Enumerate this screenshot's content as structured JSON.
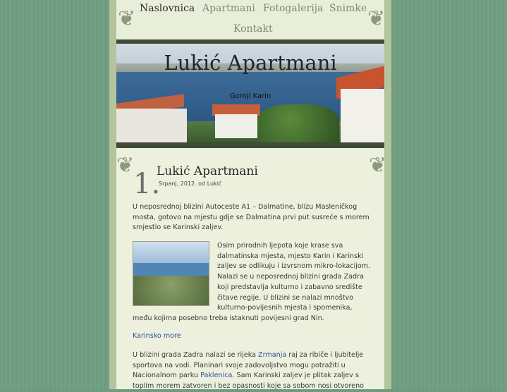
{
  "nav": {
    "items": [
      {
        "label": "Naslovnica",
        "active": true
      },
      {
        "label": "Apartmani",
        "active": false
      },
      {
        "label": "Fotogalerija",
        "active": false
      },
      {
        "label": "Snimke",
        "active": false
      },
      {
        "label": "Kontakt",
        "active": false
      }
    ]
  },
  "banner": {
    "title": "Lukić Apartmani",
    "subtitle": "Gornji Karin"
  },
  "post": {
    "number": "1.",
    "title": "Lukić Apartmani",
    "meta": "Srpanj, 2012. od Lukić",
    "para1": "U neposrednoj blizini Autoceste A1 – Dalmatine, blizu Masleničkog mosta, gotovo na mjestu gdje se Dalmatina prvi put susreće s morem smjestio se Karinski zaljev.",
    "para2": "Osim prirodnih ljepota koje krase sva dalmatinska mjesta, mjesto Karin i Karinski zaljev se odlikuju i izvrsnom mikro-lokacijom. Nalazi se u neposrednoj blizini grada Zadra koji predstavlja kulturno i zabavno središte čitave regije. U blizini se nalazi mnoštvo kulturno-povijesnih mjesta i spomenika, među kojima posebno treba istaknuti povijesni grad Nin.",
    "link_more": "Karinsko more",
    "para3_a": "U blizini grada Zadra nalazi se rijeka ",
    "para3_link1": "Zrmanja",
    "para3_b": " raj za ribiče i ljubitelje sportova na vodi. Planinari svoje zadovoljstvo mogu potražiti u Nacionalnom parku ",
    "para3_link2": "Paklenica",
    "para3_c": ". Sam Karinski zaljev je plitak zaljev s toplim morem zatvoren i bez opasnosti koje sa sobom nosi otvoreno"
  },
  "colors": {
    "background": "#6f9c80",
    "content": "#ecf0dd",
    "link": "#2f4fa0",
    "rule": "#3f4a37"
  }
}
